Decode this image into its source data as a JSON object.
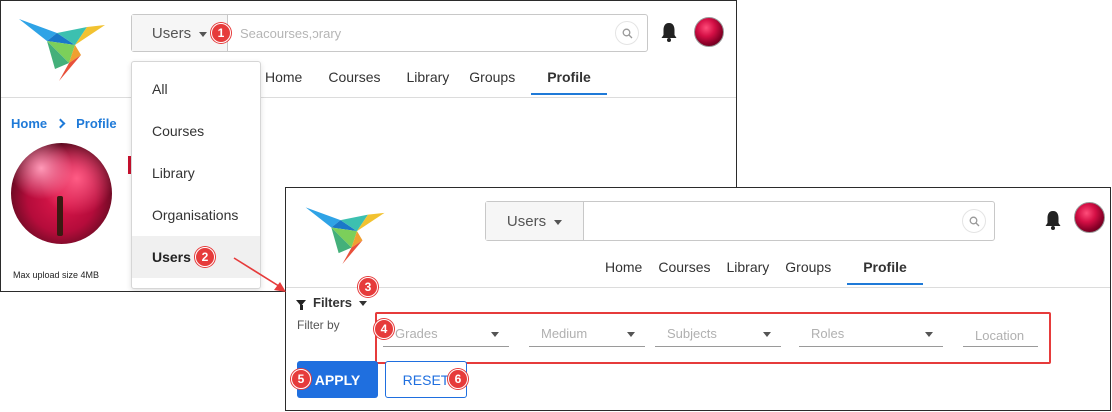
{
  "back_screen": {
    "search": {
      "scope": "Users",
      "placeholder": "Seacourses,ɔrary"
    },
    "nav": [
      "Home",
      "Courses",
      "Library",
      "Groups",
      "Profile"
    ],
    "active_nav": "Profile",
    "breadcrumb": {
      "home": "Home",
      "current": "Profile"
    },
    "upload_note": "Max upload size 4MB",
    "dropdown": {
      "items": [
        "All",
        "Courses",
        "Library",
        "Organisations",
        "Users"
      ],
      "selected": "Users"
    }
  },
  "front_screen": {
    "search": {
      "scope": "Users",
      "placeholder": ""
    },
    "nav": [
      "Home",
      "Courses",
      "Library",
      "Groups",
      "Profile"
    ],
    "active_nav": "Profile",
    "filters": {
      "title": "Filters",
      "filter_by": "Filter by",
      "fields": [
        "Grades",
        "Medium",
        "Subjects",
        "Roles",
        "Location"
      ]
    },
    "buttons": {
      "apply": "APPLY",
      "reset": "RESET"
    }
  },
  "callouts": [
    "1",
    "2",
    "3",
    "4",
    "5",
    "6"
  ],
  "colors": {
    "accent": "#1f6fdf",
    "callout": "#e63b3b",
    "link": "#1f7ad8"
  },
  "icons": [
    "hummingbird-logo",
    "chevron-down-icon",
    "search-icon",
    "bell-icon",
    "avatar",
    "chevron-right-icon",
    "filter-icon",
    "arrow-icon"
  ]
}
